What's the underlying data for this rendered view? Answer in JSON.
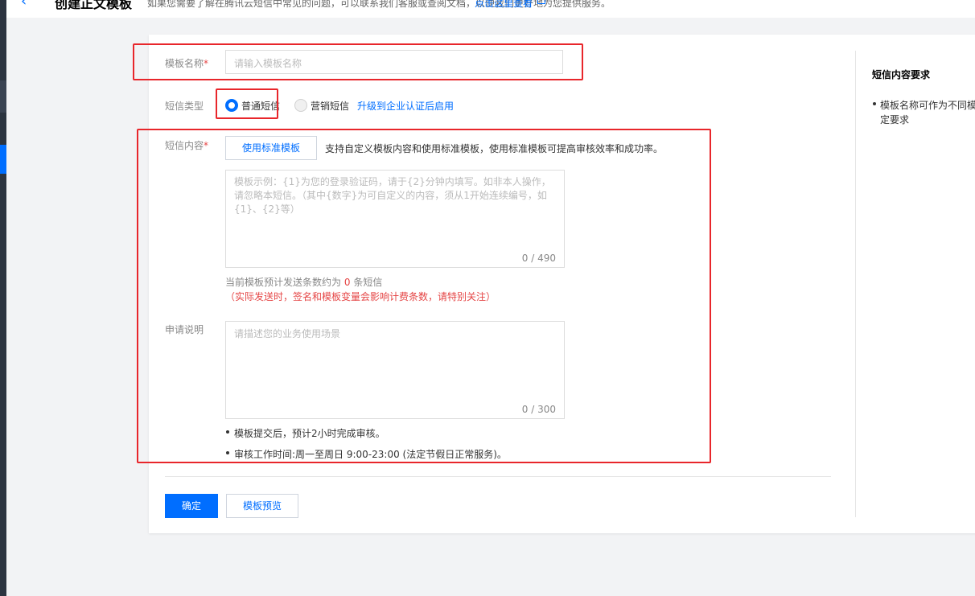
{
  "header": {
    "back_glyph": "‹",
    "title": "创建正文模板",
    "description": "如果您需要了解在腾讯云短信中常见的问题，可以联系我们客服或查阅文档，以便我们更好地为您提供服务。",
    "link_label": "点击这里查看"
  },
  "form": {
    "name": {
      "label": "模板名称",
      "required_mark": "*",
      "placeholder": "请输入模板名称"
    },
    "type": {
      "label": "短信类型",
      "options": [
        {
          "label": "普通短信",
          "selected": true
        },
        {
          "label": "营销短信",
          "selected": false
        }
      ],
      "upgrade_link": "升级到企业认证后启用"
    },
    "content": {
      "label": "短信内容",
      "required_mark": "*",
      "std_template_button": "使用标准模板",
      "std_template_desc": "支持自定义模板内容和使用标准模板，使用标准模板可提高审核效率和成功率。",
      "placeholder": "模板示例：{1}为您的登录验证码，请于{2}分钟内填写。如非本人操作，请忽略本短信。（其中{数字}为可自定义的内容，须从1开始连续编号，如{1}、{2}等）",
      "counter": "0 / 490",
      "estimate_prefix": "当前模板预计发送条数约为",
      "estimate_count": "0",
      "estimate_suffix": "条短信",
      "estimate_warning": "（实际发送时，签名和模板变量会影响计费条数，请特别关注）"
    },
    "remark": {
      "label": "申请说明",
      "placeholder": "请描述您的业务使用场景",
      "counter": "0 / 300"
    },
    "notes": [
      "模板提交后，预计2小时完成审核。",
      "审核工作时间:周一至周日 9:00-23:00 (法定节假日正常服务)。"
    ],
    "actions": {
      "confirm": "确定",
      "preview": "模板预览"
    }
  },
  "side_panel": {
    "title": "短信内容要求",
    "items": [
      "模板名称可作为不同模板的区分标识，不可作为审核的决定要求"
    ],
    "items_visible_text": "模板名称可作为不同模",
    "items_visible_text_2": "定要求"
  },
  "colors": {
    "accent": "#006eff",
    "required": "#e54545",
    "annotation": "#e8262b",
    "warning_text": "#e54545"
  }
}
